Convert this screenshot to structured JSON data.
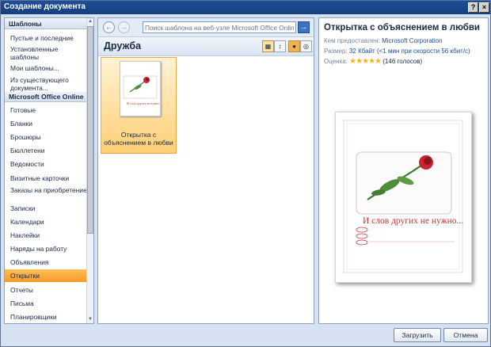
{
  "window": {
    "title": "Создание документа",
    "help_label": "?",
    "close_label": "×"
  },
  "sidebar": {
    "items": [
      {
        "label": "Шаблоны",
        "kind": "header"
      },
      {
        "label": "Пустые и последние"
      },
      {
        "label": "Установленные шаблоны"
      },
      {
        "label": "Мои шаблоны..."
      },
      {
        "label": "Из существующего документа..."
      },
      {
        "label": "Microsoft Office Online",
        "kind": "header"
      },
      {
        "label": "Готовые"
      },
      {
        "label": "Бланки"
      },
      {
        "label": "Брошюры"
      },
      {
        "label": "Бюллетени"
      },
      {
        "label": "Ведомости"
      },
      {
        "label": "Визитные карточки"
      },
      {
        "label": "Заказы на приобретение"
      },
      {
        "label": "Записки"
      },
      {
        "label": "Календари"
      },
      {
        "label": "Наклейки"
      },
      {
        "label": "Наряды на работу"
      },
      {
        "label": "Объявления"
      },
      {
        "label": "Открытки",
        "selected": true
      },
      {
        "label": "Отчеты"
      },
      {
        "label": "Письма"
      },
      {
        "label": "Планировщики"
      }
    ]
  },
  "middle": {
    "search_placeholder": "Поиск шаблона на веб-узле Microsoft Office Online",
    "category_title": "Дружба",
    "templates": [
      {
        "label": "Открытка с объяснением в любви",
        "thumb_text": "И слов других не нужно"
      }
    ]
  },
  "details": {
    "title": "Открытка с объяснением в любви",
    "provider_label": "Кем предоставлен:",
    "provider_value": "Microsoft Corporation",
    "size_label": "Размер:",
    "size_value": "32 Кбайт (<1 мин при скорости 56 кбит/с)",
    "rating_label": "Оценка:",
    "rating_value": 4.5,
    "rating_count": "(146 голосов)",
    "preview_caption": "И слов других не нужно..."
  },
  "buttons": {
    "load": "Загрузить",
    "cancel": "Отмена"
  },
  "colors": {
    "accent": "#1f4e98",
    "selection": "#f99b27",
    "rose": "#c8262f"
  }
}
